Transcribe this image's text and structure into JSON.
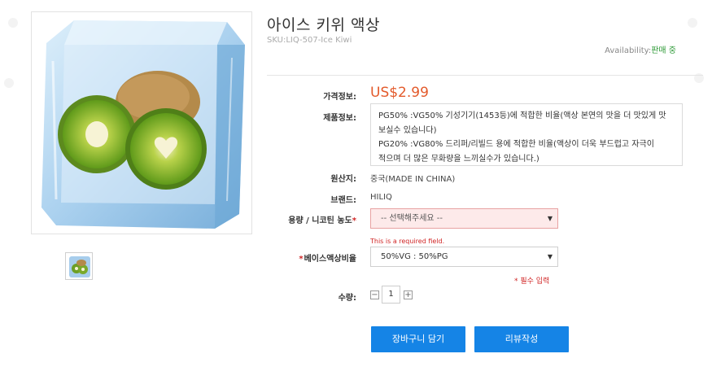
{
  "product": {
    "title": "아이스 키위 액상",
    "sku": "SKU:LIQ-507-Ice Kiwi",
    "availability_label": "Availability:",
    "availability_value": "판매 중",
    "thumb_alt": "ice kiwi thumbnail"
  },
  "fields": {
    "price_label": "가격정보:",
    "price_value": "US$2.99",
    "desc_label": "제품정보:",
    "desc_line1": "PG50% :VG50%  기성기기(1453등)에 적합한 비율(액상 본연의 맛을 더 맛있게 맛",
    "desc_line2": "보실수 있습니다)",
    "desc_line3": "PG20% :VG80%  드리퍼/리빌드 용에 적합한 비율(액상이 더욱 부드럽고 자극이",
    "desc_line4": "적으며 더 많은 무화량을 느끼실수가 있습니다.)",
    "origin_label": "원산지:",
    "origin_value": "중국(MADE IN CHINA)",
    "brand_label": "브랜드:",
    "brand_value": "HILIQ",
    "volume_label": "용량 / 니코틴 농도",
    "volume_required_mark": "*",
    "volume_placeholder": "-- 선택해주세요 --",
    "volume_error": "This is a required field.",
    "base_required_mark": "*",
    "base_label": "베이스액상비율",
    "base_selected": "50%VG : 50%PG",
    "required_note": "* 필수 입력",
    "qty_label": "수량:",
    "qty_value": "1",
    "qty_minus": "−",
    "qty_plus": "+"
  },
  "buttons": {
    "cart": "장바구니 담기",
    "review": "리뷰작성"
  },
  "colors": {
    "price": "#e35a2b",
    "button": "#1584e6",
    "available": "#2e9a37",
    "required": "#d02525"
  }
}
